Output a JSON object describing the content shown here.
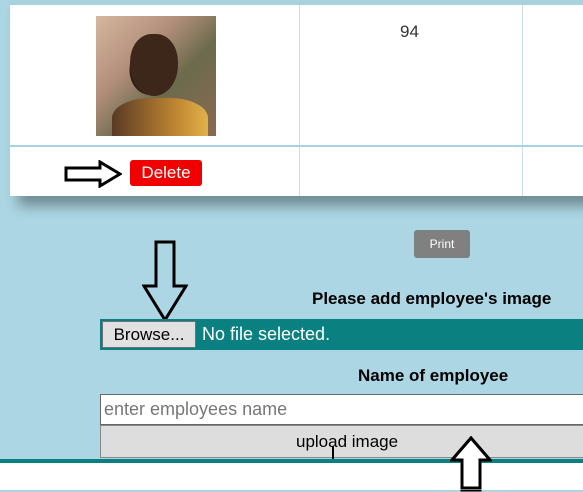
{
  "table": {
    "row_value": "94",
    "delete_label": "Delete"
  },
  "print_label": "Print",
  "form": {
    "image_label": "Please add employee's image",
    "browse_label": "Browse...",
    "file_status": "No file selected.",
    "name_label": "Name of employee",
    "name_placeholder": "enter employees name",
    "name_value": "",
    "upload_label": "upload image"
  },
  "colors": {
    "page_background": "#acd6e3",
    "delete_red": "#f00000",
    "teal": "#0a8080",
    "print_gray": "#808080"
  }
}
